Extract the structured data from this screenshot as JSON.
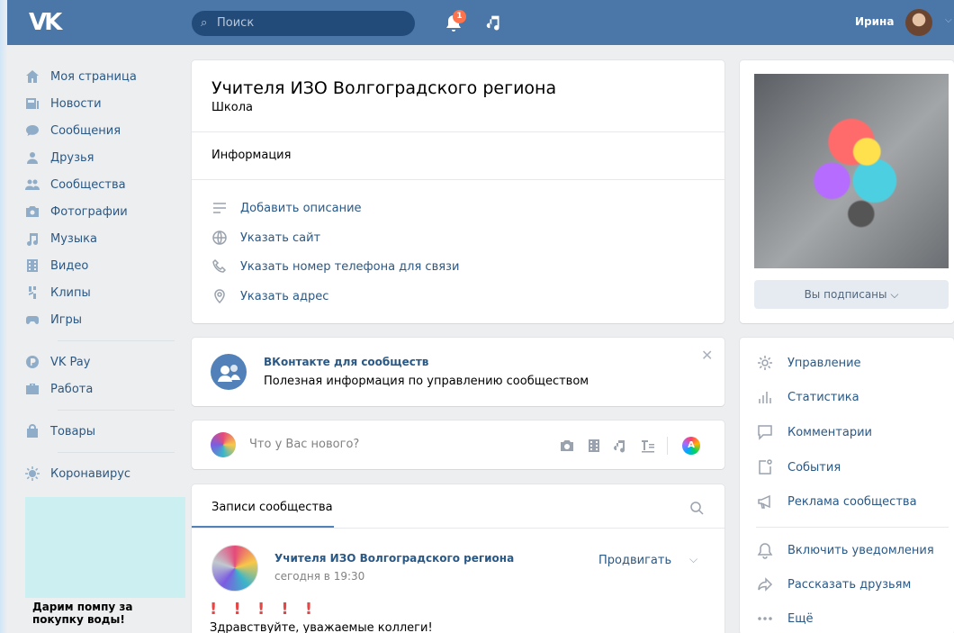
{
  "header": {
    "search_placeholder": "Поиск",
    "notifications_count": "1",
    "user_name": "Ирина"
  },
  "nav": {
    "items": [
      {
        "label": "Моя страница",
        "icon": "home-icon"
      },
      {
        "label": "Новости",
        "icon": "news-icon"
      },
      {
        "label": "Сообщения",
        "icon": "messages-icon"
      },
      {
        "label": "Друзья",
        "icon": "friends-icon"
      },
      {
        "label": "Сообщества",
        "icon": "groups-icon"
      },
      {
        "label": "Фотографии",
        "icon": "photos-icon"
      },
      {
        "label": "Музыка",
        "icon": "music-icon"
      },
      {
        "label": "Видео",
        "icon": "video-icon"
      },
      {
        "label": "Клипы",
        "icon": "clips-icon"
      },
      {
        "label": "Игры",
        "icon": "games-icon"
      }
    ],
    "items2": [
      {
        "label": "VK Pay",
        "icon": "vkpay-icon"
      },
      {
        "label": "Работа",
        "icon": "work-icon"
      }
    ],
    "goods": "Товары",
    "covid": "Коронавирус",
    "ad_text": "Дарим помпу за покупку воды!"
  },
  "info_card": {
    "title": "Учителя ИЗО Волгоградского региона",
    "subtitle": "Школа",
    "section": "Информация",
    "rows": [
      "Добавить описание",
      "Указать сайт",
      "Указать номер телефона для связи",
      "Указать адрес"
    ]
  },
  "vk_card": {
    "title": "ВКонтакте для сообществ",
    "subtitle": "Полезная информация по управлению сообществом"
  },
  "post_box": {
    "placeholder": "Что у Вас нового?",
    "pen_letter": "A"
  },
  "wall": {
    "tab": "Записи сообщества",
    "author": "Учителя ИЗО Волгоградского региона",
    "time": "сегодня в 19:30",
    "promote": "Продвигать",
    "exclamations": "! ! ! ! !",
    "greeting": "Здравствуйте, уважаемые коллеги!"
  },
  "cover": {
    "subscribed": "Вы подписаны ⌵"
  },
  "actions": {
    "items": [
      "Управление",
      "Статистика",
      "Комментарии",
      "События",
      "Реклама сообщества"
    ],
    "items2": [
      "Включить уведомления",
      "Рассказать друзьям",
      "Ещё"
    ]
  }
}
